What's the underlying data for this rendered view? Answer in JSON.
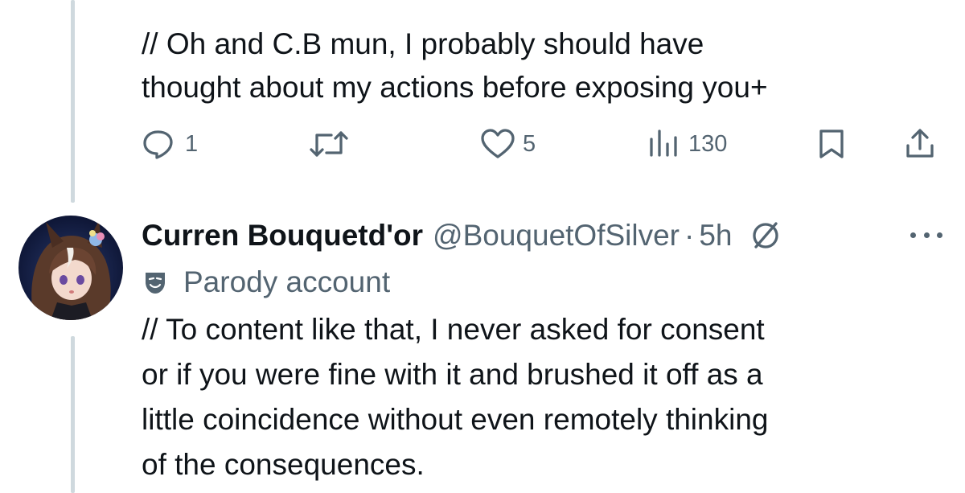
{
  "previous_tweet": {
    "text_line1": "// Oh and C.B mun, I probably should have",
    "text_line2": "thought about my actions before exposing you+",
    "actions": {
      "reply_count": "1",
      "retweet_count": "",
      "like_count": "5",
      "view_count": "130"
    }
  },
  "tweet": {
    "display_name": "Curren Bouquetd'or",
    "handle": "@BouquetOfSilver",
    "separator": "·",
    "time": "5h",
    "account_label": "Parody account",
    "text_line1": "// To content like that, I never asked for consent",
    "text_line2": "or if you were fine with it and brushed it off as a",
    "text_line3": "little coincidence without even remotely thinking",
    "text_line4": "of the consequences."
  },
  "colors": {
    "text_primary": "#0f1419",
    "text_secondary": "#536471",
    "thread_line": "#cfd9de",
    "background": "#ffffff"
  },
  "icons": {
    "reply": "reply-icon",
    "retweet": "retweet-icon",
    "like": "heart-icon",
    "views": "views-icon",
    "bookmark": "bookmark-icon",
    "share": "share-icon",
    "verified": "verified-icon",
    "more": "more-icon",
    "parody": "mask-icon"
  }
}
